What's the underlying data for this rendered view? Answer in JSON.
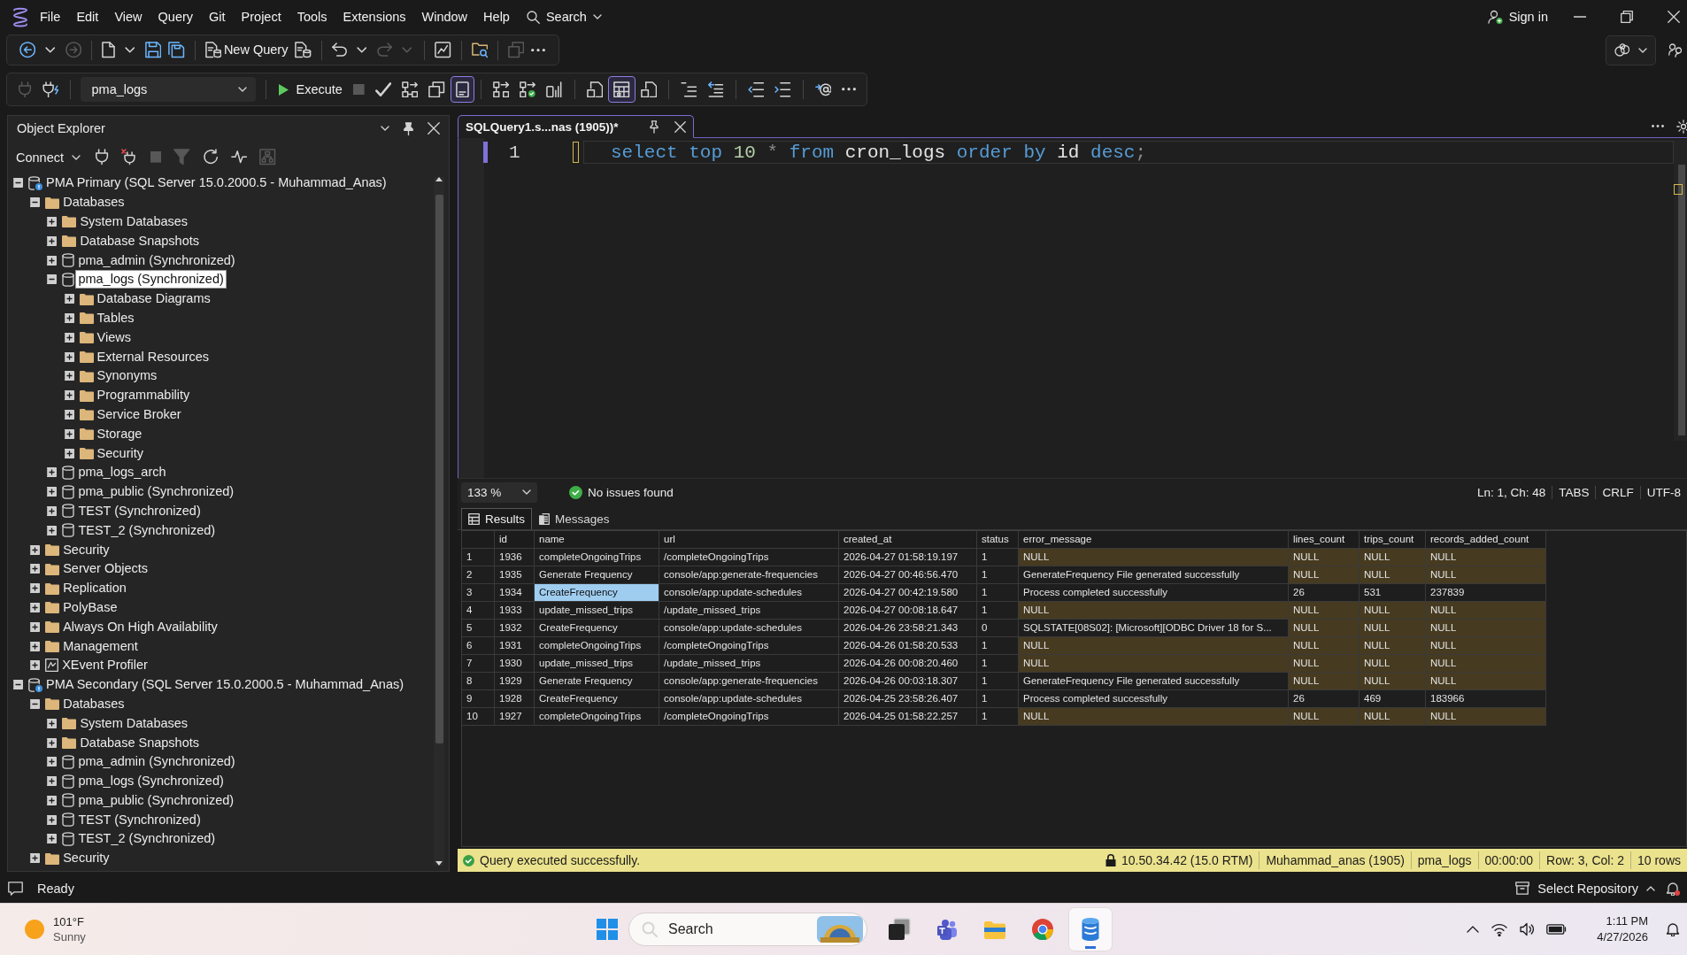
{
  "menu_bar": {
    "items": [
      "File",
      "Edit",
      "View",
      "Query",
      "Git",
      "Project",
      "Tools",
      "Extensions",
      "Window",
      "Help"
    ],
    "search": "Search",
    "sign_in": "Sign in"
  },
  "main_toolbar": {
    "new_query": "New Query",
    "buttons": [
      {
        "disabled": false
      },
      {
        "disabled": false
      },
      {
        "disabled": true
      },
      {
        "disabled": false
      },
      {
        "disabled": false
      },
      {
        "disabled": false
      },
      {
        "disabled": false
      },
      {
        "disabled": false
      },
      {
        "disabled": false
      },
      {
        "disabled": false
      },
      {
        "disabled": true
      },
      {
        "disabled": true
      },
      {
        "disabled": false
      },
      {
        "disabled": false
      },
      {
        "disabled": true
      },
      {
        "disabled": false
      }
    ]
  },
  "query_toolbar": {
    "database": "pma_logs",
    "execute": "Execute",
    "buttons": [
      {
        "disabled": true,
        "on": false
      },
      {
        "disabled": false,
        "on": false
      },
      {
        "disabled": true,
        "on": false
      },
      {
        "disabled": false,
        "on": false
      },
      {
        "disabled": false,
        "on": false
      },
      {
        "disabled": false,
        "on": false
      },
      {
        "disabled": false,
        "on": true
      },
      {
        "disabled": false,
        "on": false
      },
      {
        "disabled": false,
        "on": false
      },
      {
        "disabled": false,
        "on": false
      },
      {
        "disabled": false,
        "on": false
      },
      {
        "disabled": false,
        "on": true
      },
      {
        "disabled": false,
        "on": false
      },
      {
        "disabled": false,
        "on": false
      },
      {
        "disabled": false,
        "on": false
      },
      {
        "disabled": false,
        "on": false
      },
      {
        "disabled": false,
        "on": false
      },
      {
        "disabled": false,
        "on": false
      },
      {
        "disabled": false,
        "on": false
      }
    ]
  },
  "object_explorer": {
    "title": "Object Explorer",
    "connect": "Connect",
    "buttons": [
      {
        "disabled": false
      },
      {
        "disabled": false
      },
      {
        "disabled": true
      },
      {
        "disabled": true
      },
      {
        "disabled": false
      },
      {
        "disabled": false
      },
      {
        "disabled": true
      }
    ],
    "tree": [
      {
        "label": "PMA Primary (SQL Server 15.0.2000.5 - Muhammad_Anas)",
        "kind": "server",
        "expanded": true,
        "selected": false,
        "children": [
          {
            "label": "Databases",
            "kind": "folder",
            "expanded": true,
            "selected": false,
            "children": [
              {
                "label": "System Databases",
                "kind": "folder",
                "expanded": false,
                "selected": false
              },
              {
                "label": "Database Snapshots",
                "kind": "folder",
                "expanded": false,
                "selected": false
              },
              {
                "label": "pma_admin (Synchronized)",
                "kind": "database",
                "expanded": false,
                "selected": false
              },
              {
                "label": "pma_logs (Synchronized)",
                "kind": "database",
                "expanded": true,
                "selected": true,
                "children": [
                  {
                    "label": "Database Diagrams",
                    "kind": "folder",
                    "expanded": false,
                    "selected": false
                  },
                  {
                    "label": "Tables",
                    "kind": "folder",
                    "expanded": false,
                    "selected": false
                  },
                  {
                    "label": "Views",
                    "kind": "folder",
                    "expanded": false,
                    "selected": false
                  },
                  {
                    "label": "External Resources",
                    "kind": "folder",
                    "expanded": false,
                    "selected": false
                  },
                  {
                    "label": "Synonyms",
                    "kind": "folder",
                    "expanded": false,
                    "selected": false
                  },
                  {
                    "label": "Programmability",
                    "kind": "folder",
                    "expanded": false,
                    "selected": false
                  },
                  {
                    "label": "Service Broker",
                    "kind": "folder",
                    "expanded": false,
                    "selected": false
                  },
                  {
                    "label": "Storage",
                    "kind": "folder",
                    "expanded": false,
                    "selected": false
                  },
                  {
                    "label": "Security",
                    "kind": "folder",
                    "expanded": false,
                    "selected": false
                  }
                ]
              },
              {
                "label": "pma_logs_arch",
                "kind": "database",
                "expanded": false,
                "selected": false
              },
              {
                "label": "pma_public (Synchronized)",
                "kind": "database",
                "expanded": false,
                "selected": false
              },
              {
                "label": "TEST (Synchronized)",
                "kind": "database",
                "expanded": false,
                "selected": false
              },
              {
                "label": "TEST_2 (Synchronized)",
                "kind": "database",
                "expanded": false,
                "selected": false
              }
            ]
          },
          {
            "label": "Security",
            "kind": "folder",
            "expanded": false,
            "selected": false
          },
          {
            "label": "Server Objects",
            "kind": "folder",
            "expanded": false,
            "selected": false
          },
          {
            "label": "Replication",
            "kind": "folder",
            "expanded": false,
            "selected": false
          },
          {
            "label": "PolyBase",
            "kind": "folder",
            "expanded": false,
            "selected": false
          },
          {
            "label": "Always On High Availability",
            "kind": "folder",
            "expanded": false,
            "selected": false
          },
          {
            "label": "Management",
            "kind": "folder",
            "expanded": false,
            "selected": false
          },
          {
            "label": "XEvent Profiler",
            "kind": "profiler",
            "expanded": false,
            "selected": false
          }
        ]
      },
      {
        "label": "PMA Secondary (SQL Server 15.0.2000.5 - Muhammad_Anas)",
        "kind": "server",
        "expanded": true,
        "selected": false,
        "children": [
          {
            "label": "Databases",
            "kind": "folder",
            "expanded": true,
            "selected": false,
            "children": [
              {
                "label": "System Databases",
                "kind": "folder",
                "expanded": false,
                "selected": false
              },
              {
                "label": "Database Snapshots",
                "kind": "folder",
                "expanded": false,
                "selected": false
              },
              {
                "label": "pma_admin (Synchronized)",
                "kind": "database",
                "expanded": false,
                "selected": false
              },
              {
                "label": "pma_logs (Synchronized)",
                "kind": "database",
                "expanded": false,
                "selected": false
              },
              {
                "label": "pma_public (Synchronized)",
                "kind": "database",
                "expanded": false,
                "selected": false
              },
              {
                "label": "TEST (Synchronized)",
                "kind": "database",
                "expanded": false,
                "selected": false
              },
              {
                "label": "TEST_2 (Synchronized)",
                "kind": "database",
                "expanded": false,
                "selected": false
              }
            ]
          },
          {
            "label": "Security",
            "kind": "folder",
            "expanded": false,
            "selected": false
          }
        ]
      }
    ]
  },
  "editor": {
    "tabs": [
      {
        "title": "SQLQuery1.s...nas (1905))*",
        "selected": true
      }
    ],
    "line_number": "1",
    "code": [
      {
        "kind": "keyword",
        "text": "select"
      },
      {
        "kind": "keyword",
        "text": "top"
      },
      {
        "kind": "number",
        "text": "10"
      },
      {
        "kind": "operator",
        "text": "*"
      },
      {
        "kind": "keyword",
        "text": "from"
      },
      {
        "kind": "identifier",
        "text": "cron_logs"
      },
      {
        "kind": "keyword",
        "text": "order"
      },
      {
        "kind": "keyword",
        "text": "by"
      },
      {
        "kind": "identifier",
        "text": "id"
      },
      {
        "kind": "keyword",
        "text": "desc"
      },
      {
        "kind": "punctuation",
        "text": ";"
      }
    ],
    "zoom": "133 %",
    "issues": "No issues found",
    "position": "Ln: 1, Ch: 48",
    "indentation": "TABS",
    "line_ending": "CRLF",
    "encoding": "UTF-8"
  },
  "results": {
    "tabs": [
      {
        "label": "Results",
        "selected": true
      },
      {
        "label": "Messages",
        "selected": false
      }
    ],
    "columns": [
      "id",
      "name",
      "url",
      "created_at",
      "status",
      "error_message",
      "lines_count",
      "trips_count",
      "records_added_count"
    ],
    "rows": [
      {
        "number": "1",
        "cells": [
          {
            "text": "1936",
            "is_null": false,
            "selected": false
          },
          {
            "text": "completeOngoingTrips",
            "is_null": false,
            "selected": false
          },
          {
            "text": "/completeOngoingTrips",
            "is_null": false,
            "selected": false
          },
          {
            "text": "2026-04-27 01:58:19.197",
            "is_null": false,
            "selected": false
          },
          {
            "text": "1",
            "is_null": false,
            "selected": false
          },
          {
            "text": "NULL",
            "is_null": true,
            "selected": false
          },
          {
            "text": "NULL",
            "is_null": true,
            "selected": false
          },
          {
            "text": "NULL",
            "is_null": true,
            "selected": false
          },
          {
            "text": "NULL",
            "is_null": true,
            "selected": false
          }
        ]
      },
      {
        "number": "2",
        "cells": [
          {
            "text": "1935",
            "is_null": false,
            "selected": false
          },
          {
            "text": "Generate Frequency",
            "is_null": false,
            "selected": false
          },
          {
            "text": "console/app:generate-frequencies",
            "is_null": false,
            "selected": false
          },
          {
            "text": "2026-04-27 00:46:56.470",
            "is_null": false,
            "selected": false
          },
          {
            "text": "1",
            "is_null": false,
            "selected": false
          },
          {
            "text": "GenerateFrequency File generated successfully",
            "is_null": false,
            "selected": false
          },
          {
            "text": "NULL",
            "is_null": true,
            "selected": false
          },
          {
            "text": "NULL",
            "is_null": true,
            "selected": false
          },
          {
            "text": "NULL",
            "is_null": true,
            "selected": false
          }
        ]
      },
      {
        "number": "3",
        "cells": [
          {
            "text": "1934",
            "is_null": false,
            "selected": false
          },
          {
            "text": "CreateFrequency",
            "is_null": false,
            "selected": true
          },
          {
            "text": "console/app:update-schedules",
            "is_null": false,
            "selected": false
          },
          {
            "text": "2026-04-27 00:42:19.580",
            "is_null": false,
            "selected": false
          },
          {
            "text": "1",
            "is_null": false,
            "selected": false
          },
          {
            "text": "Process completed successfully",
            "is_null": false,
            "selected": false
          },
          {
            "text": "26",
            "is_null": false,
            "selected": false
          },
          {
            "text": "531",
            "is_null": false,
            "selected": false
          },
          {
            "text": "237839",
            "is_null": false,
            "selected": false
          }
        ]
      },
      {
        "number": "4",
        "cells": [
          {
            "text": "1933",
            "is_null": false,
            "selected": false
          },
          {
            "text": "update_missed_trips",
            "is_null": false,
            "selected": false
          },
          {
            "text": "/update_missed_trips",
            "is_null": false,
            "selected": false
          },
          {
            "text": "2026-04-27 00:08:18.647",
            "is_null": false,
            "selected": false
          },
          {
            "text": "1",
            "is_null": false,
            "selected": false
          },
          {
            "text": "NULL",
            "is_null": true,
            "selected": false
          },
          {
            "text": "NULL",
            "is_null": true,
            "selected": false
          },
          {
            "text": "NULL",
            "is_null": true,
            "selected": false
          },
          {
            "text": "NULL",
            "is_null": true,
            "selected": false
          }
        ]
      },
      {
        "number": "5",
        "cells": [
          {
            "text": "1932",
            "is_null": false,
            "selected": false
          },
          {
            "text": "CreateFrequency",
            "is_null": false,
            "selected": false
          },
          {
            "text": "console/app:update-schedules",
            "is_null": false,
            "selected": false
          },
          {
            "text": "2026-04-26 23:58:21.343",
            "is_null": false,
            "selected": false
          },
          {
            "text": "0",
            "is_null": false,
            "selected": false
          },
          {
            "text": "SQLSTATE[08S02]: [Microsoft][ODBC Driver 18 for S...",
            "is_null": false,
            "selected": false
          },
          {
            "text": "NULL",
            "is_null": true,
            "selected": false
          },
          {
            "text": "NULL",
            "is_null": true,
            "selected": false
          },
          {
            "text": "NULL",
            "is_null": true,
            "selected": false
          }
        ]
      },
      {
        "number": "6",
        "cells": [
          {
            "text": "1931",
            "is_null": false,
            "selected": false
          },
          {
            "text": "completeOngoingTrips",
            "is_null": false,
            "selected": false
          },
          {
            "text": "/completeOngoingTrips",
            "is_null": false,
            "selected": false
          },
          {
            "text": "2026-04-26 01:58:20.533",
            "is_null": false,
            "selected": false
          },
          {
            "text": "1",
            "is_null": false,
            "selected": false
          },
          {
            "text": "NULL",
            "is_null": true,
            "selected": false
          },
          {
            "text": "NULL",
            "is_null": true,
            "selected": false
          },
          {
            "text": "NULL",
            "is_null": true,
            "selected": false
          },
          {
            "text": "NULL",
            "is_null": true,
            "selected": false
          }
        ]
      },
      {
        "number": "7",
        "cells": [
          {
            "text": "1930",
            "is_null": false,
            "selected": false
          },
          {
            "text": "update_missed_trips",
            "is_null": false,
            "selected": false
          },
          {
            "text": "/update_missed_trips",
            "is_null": false,
            "selected": false
          },
          {
            "text": "2026-04-26 00:08:20.460",
            "is_null": false,
            "selected": false
          },
          {
            "text": "1",
            "is_null": false,
            "selected": false
          },
          {
            "text": "NULL",
            "is_null": true,
            "selected": false
          },
          {
            "text": "NULL",
            "is_null": true,
            "selected": false
          },
          {
            "text": "NULL",
            "is_null": true,
            "selected": false
          },
          {
            "text": "NULL",
            "is_null": true,
            "selected": false
          }
        ]
      },
      {
        "number": "8",
        "cells": [
          {
            "text": "1929",
            "is_null": false,
            "selected": false
          },
          {
            "text": "Generate Frequency",
            "is_null": false,
            "selected": false
          },
          {
            "text": "console/app:generate-frequencies",
            "is_null": false,
            "selected": false
          },
          {
            "text": "2026-04-26 00:03:18.307",
            "is_null": false,
            "selected": false
          },
          {
            "text": "1",
            "is_null": false,
            "selected": false
          },
          {
            "text": "GenerateFrequency File generated successfully",
            "is_null": false,
            "selected": false
          },
          {
            "text": "NULL",
            "is_null": true,
            "selected": false
          },
          {
            "text": "NULL",
            "is_null": true,
            "selected": false
          },
          {
            "text": "NULL",
            "is_null": true,
            "selected": false
          }
        ]
      },
      {
        "number": "9",
        "cells": [
          {
            "text": "1928",
            "is_null": false,
            "selected": false
          },
          {
            "text": "CreateFrequency",
            "is_null": false,
            "selected": false
          },
          {
            "text": "console/app:update-schedules",
            "is_null": false,
            "selected": false
          },
          {
            "text": "2026-04-25 23:58:26.407",
            "is_null": false,
            "selected": false
          },
          {
            "text": "1",
            "is_null": false,
            "selected": false
          },
          {
            "text": "Process completed successfully",
            "is_null": false,
            "selected": false
          },
          {
            "text": "26",
            "is_null": false,
            "selected": false
          },
          {
            "text": "469",
            "is_null": false,
            "selected": false
          },
          {
            "text": "183966",
            "is_null": false,
            "selected": false
          }
        ]
      },
      {
        "number": "10",
        "cells": [
          {
            "text": "1927",
            "is_null": false,
            "selected": false
          },
          {
            "text": "completeOngoingTrips",
            "is_null": false,
            "selected": false
          },
          {
            "text": "/completeOngoingTrips",
            "is_null": false,
            "selected": false
          },
          {
            "text": "2026-04-25 01:58:22.257",
            "is_null": false,
            "selected": false
          },
          {
            "text": "1",
            "is_null": false,
            "selected": false
          },
          {
            "text": "NULL",
            "is_null": true,
            "selected": false
          },
          {
            "text": "NULL",
            "is_null": true,
            "selected": false
          },
          {
            "text": "NULL",
            "is_null": true,
            "selected": false
          },
          {
            "text": "NULL",
            "is_null": true,
            "selected": false
          }
        ]
      }
    ]
  },
  "query_status": {
    "message": "Query executed successfully.",
    "server": "10.50.34.42 (15.0 RTM)",
    "user": "Muhammad_anas (1905)",
    "database": "pma_logs",
    "elapsed": "00:00:00",
    "cursor": "Row: 3, Col: 2",
    "row_count": "10 rows"
  },
  "status_bar": {
    "text": "Ready",
    "repository": "Select Repository"
  },
  "taskbar": {
    "weather": {
      "temperature": "101°F",
      "condition": "Sunny"
    },
    "search": {
      "placeholder": "Search"
    },
    "apps": [
      {
        "selected": false
      },
      {
        "selected": false
      },
      {
        "selected": false
      },
      {
        "selected": false
      },
      {
        "selected": true
      }
    ],
    "time": "1:11 PM",
    "date": "4/27/2026"
  }
}
